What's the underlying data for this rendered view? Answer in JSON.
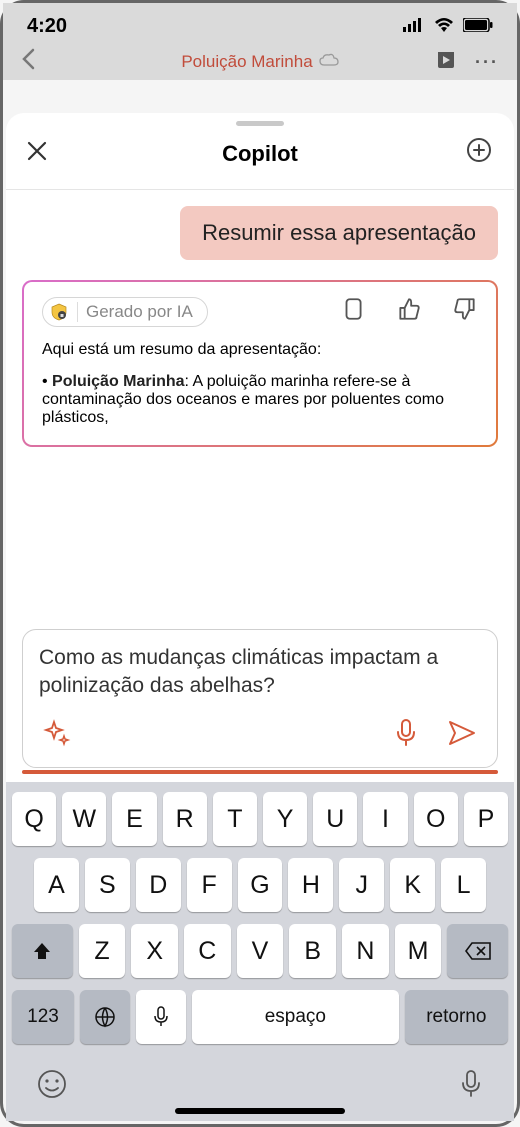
{
  "status": {
    "time": "4:20"
  },
  "background": {
    "title": "Poluição Marinha"
  },
  "sheet": {
    "title": "Copilot"
  },
  "chat": {
    "user_message": "Resumir essa apresentação",
    "ai_badge_label": "Gerado por IA",
    "ai_intro": "Aqui está um resumo da apresentação:",
    "ai_bullet_title": "Poluição Marinha",
    "ai_bullet_text": ": A poluição marinha refere-se à contaminação dos oceanos e mares por poluentes como plásticos,"
  },
  "input": {
    "text": "Como as mudanças climáticas impactam a polinização das abelhas?"
  },
  "keyboard": {
    "row1": [
      "Q",
      "W",
      "E",
      "R",
      "T",
      "Y",
      "U",
      "I",
      "O",
      "P"
    ],
    "row2": [
      "A",
      "S",
      "D",
      "F",
      "G",
      "H",
      "J",
      "K",
      "L"
    ],
    "row3": [
      "Z",
      "X",
      "C",
      "V",
      "B",
      "N",
      "M"
    ],
    "num_label": "123",
    "space_label": "espaço",
    "return_label": "retorno"
  }
}
